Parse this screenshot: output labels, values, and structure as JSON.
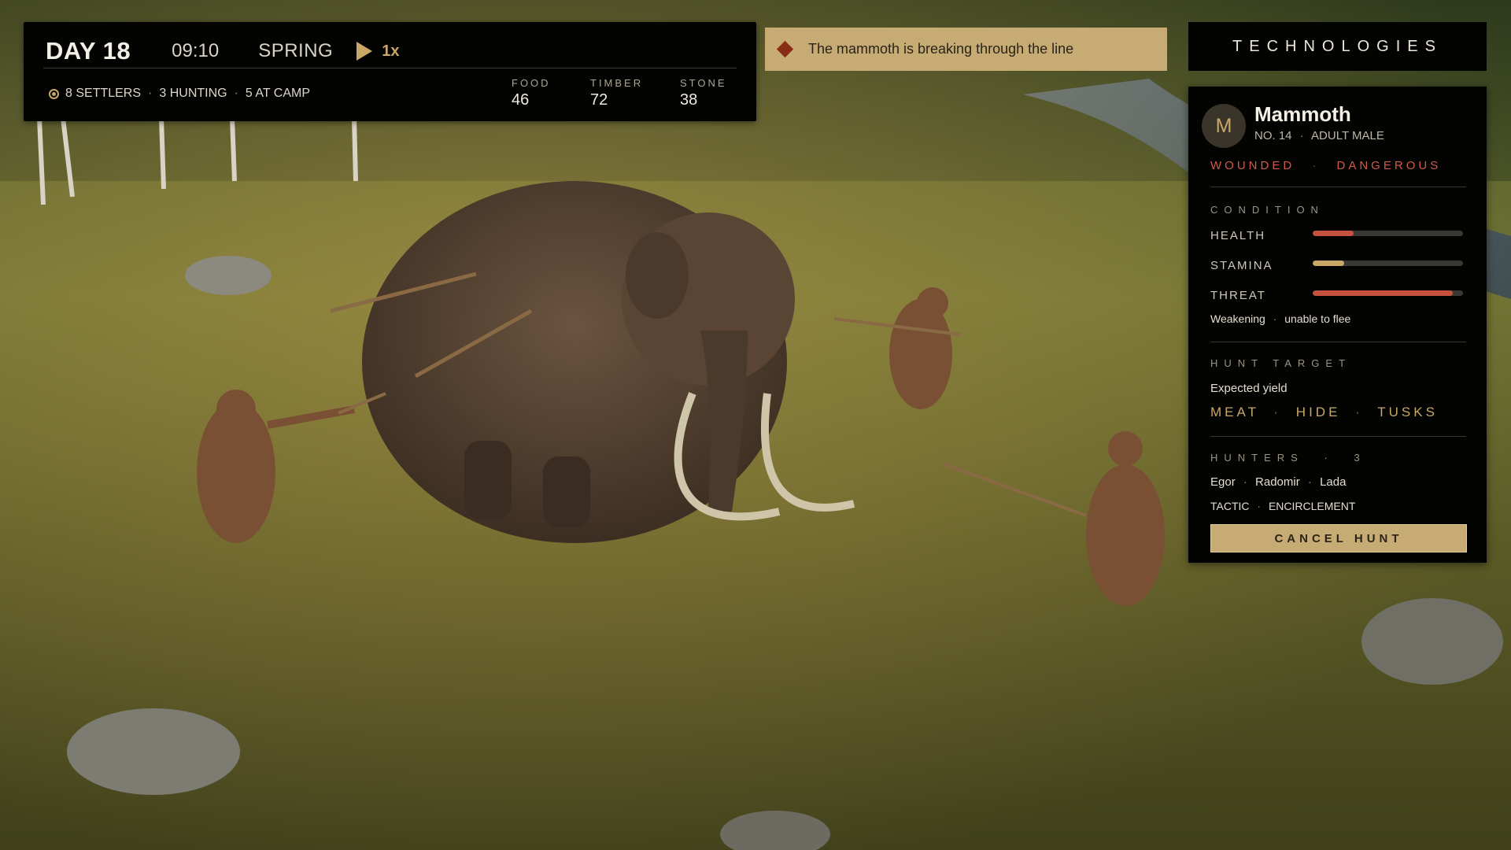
{
  "hud": {
    "day": "DAY 18",
    "time": "09:10",
    "season": "SPRING",
    "speed": "1x",
    "settlers": "8 SETTLERS",
    "hunting": "3 HUNTING",
    "at_camp": "5 AT CAMP",
    "resources": [
      {
        "label": "FOOD",
        "value": "46"
      },
      {
        "label": "TIMBER",
        "value": "72"
      },
      {
        "label": "STONE",
        "value": "38"
      }
    ]
  },
  "alert": {
    "message": "The mammoth is breaking through the line"
  },
  "technologies": {
    "label": "TECHNOLOGIES"
  },
  "target": {
    "initial": "M",
    "name": "Mammoth",
    "number": "NO. 14",
    "type": "ADULT MALE",
    "tags": [
      "WOUNDED",
      "DANGEROUS"
    ],
    "condition_title": "CONDITION",
    "stats": [
      {
        "label": "HEALTH",
        "value": 0.27,
        "color": "#c4523f"
      },
      {
        "label": "STAMINA",
        "value": 0.21,
        "color": "#c9a766"
      },
      {
        "label": "THREAT",
        "value": 0.93,
        "color": "#c4523f"
      }
    ],
    "condition_note_a": "Weakening",
    "condition_note_b": "unable to flee",
    "hunt_title": "HUNT TARGET",
    "yield_label": "Expected yield",
    "yield_items": [
      "MEAT",
      "HIDE",
      "TUSKS"
    ],
    "hunters_title": "HUNTERS",
    "hunters_count": "3",
    "hunters": [
      "Egor",
      "Radomir",
      "Lada"
    ],
    "tactic_label": "TACTIC",
    "tactic_value": "ENCIRCLEMENT",
    "cancel_label": "CANCEL HUNT"
  }
}
